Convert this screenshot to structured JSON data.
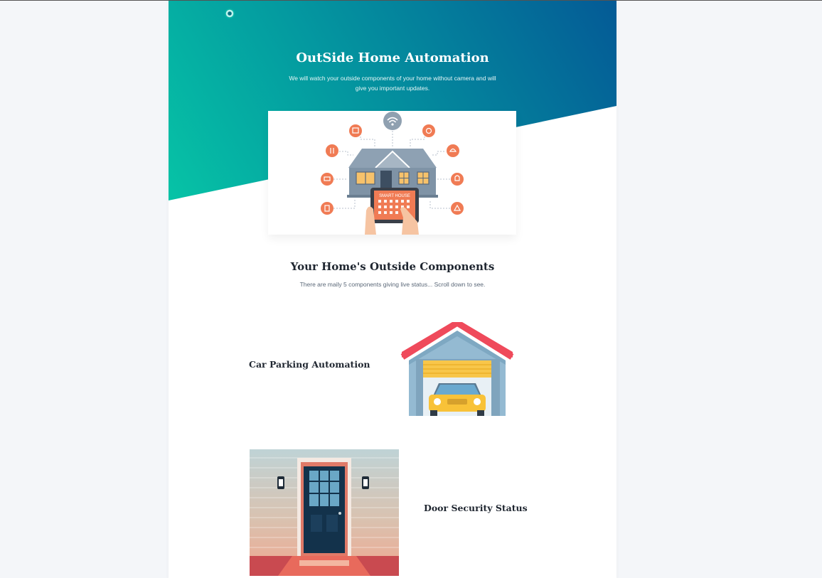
{
  "hero": {
    "title": "OutSide Home Automation",
    "subtitle": "We will watch your outside components of your home without camera and will give you important updates.",
    "image_text": "SMART HOUSE"
  },
  "components_section": {
    "title": "Your Home's Outside Components",
    "subtitle": "There are maily 5 components giving live status... Scroll down to see."
  },
  "features": [
    {
      "title": "Car Parking Automation"
    },
    {
      "title": "Door Security Status"
    }
  ],
  "colors": {
    "page_bg": "#f4f6f9",
    "hero_gradient_start": "#06c4a6",
    "hero_gradient_end": "#045a96",
    "icon_accent": "#f07b54",
    "heading": "#1f2630"
  }
}
